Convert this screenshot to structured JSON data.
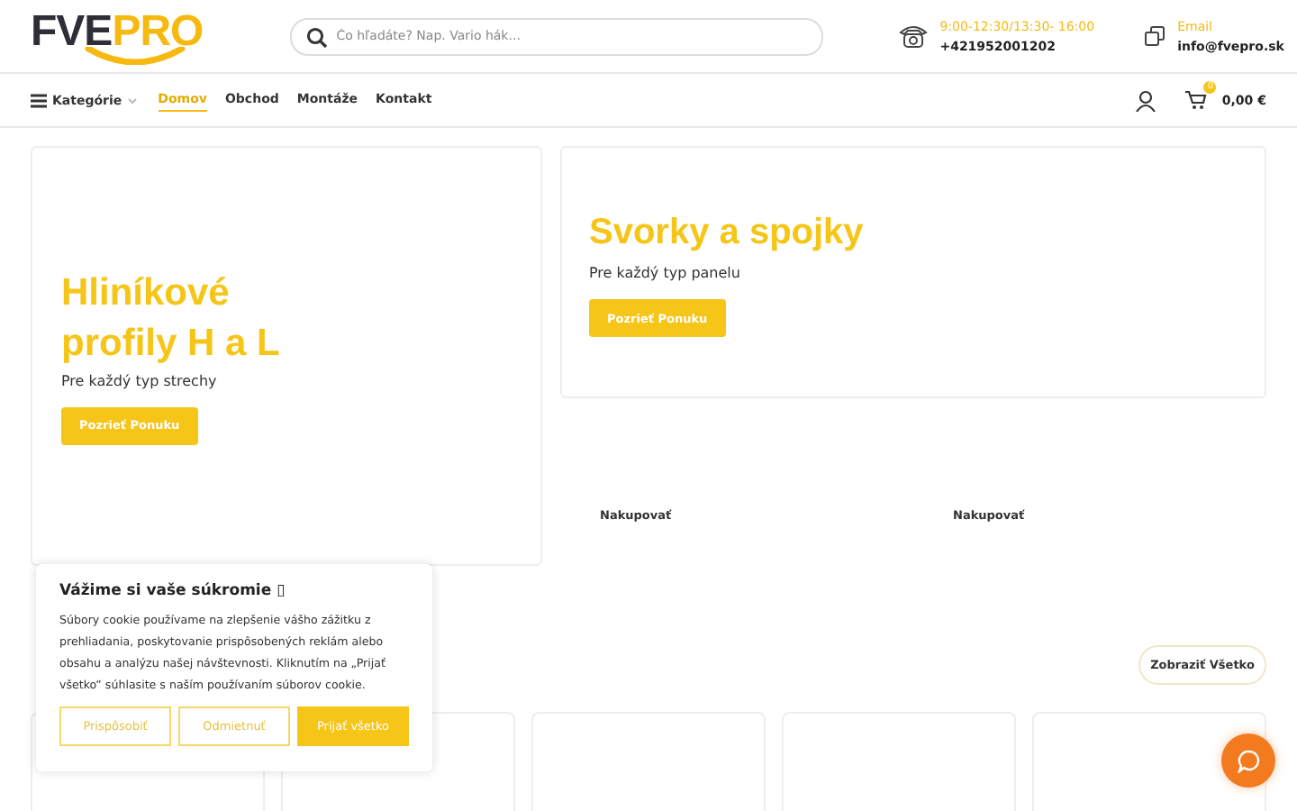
{
  "header": {
    "logo": {
      "left": "FVE",
      "right": "PRO"
    },
    "search": {
      "placeholder": "Čo hľadáte? Nap. Vario hák..."
    },
    "phone": {
      "hours": "9:00-12:30/13:30- 16:00",
      "number": "+421952001202"
    },
    "email": {
      "label": "Email",
      "address": "info@fvepro.sk"
    }
  },
  "nav": {
    "categories": "Kategórie",
    "items": [
      {
        "label": "Domov",
        "selected": true
      },
      {
        "label": "Obchod",
        "selected": false
      },
      {
        "label": "Montáže",
        "selected": false
      },
      {
        "label": "Kontakt",
        "selected": false
      }
    ],
    "cart": {
      "count": "0",
      "total": "0,00 €"
    }
  },
  "hero_left": {
    "title_lines": [
      "Hliníkové",
      "profily H a L"
    ],
    "subtitle": "Pre každý typ strechy",
    "button": "Pozrieť Ponuku"
  },
  "hero_right": {
    "title": "Svorky a spojky",
    "subtitle": "Pre každý typ panelu",
    "button": "Pozrieť Ponuku"
  },
  "shop_links": [
    "Nakupovať",
    "Nakupovať"
  ],
  "section": {
    "button": "Zobraziť Všetko"
  },
  "product_cards": [
    {
      "kind": "empty"
    },
    {
      "kind": "empty"
    },
    {
      "kind": "empty"
    },
    {
      "kind": "empty"
    },
    {
      "kind": "empty"
    }
  ],
  "cookie": {
    "title": "Vážime si vaše súkromie ▯",
    "text": "Súbory cookie používame na zlepšenie vášho zážitku z prehliadania, poskytovanie prispôsobených reklám alebo obsahu a analýzu našej návštevnosti. Kliknutím na „Prijať všetko“ súhlasite s naším používaním súborov cookie.",
    "buttons": [
      {
        "label": "Prispôsobiť",
        "kind": "outline"
      },
      {
        "label": "Odmietnuť",
        "kind": "outline"
      },
      {
        "label": "Prijať všetko",
        "kind": "filled"
      }
    ]
  }
}
